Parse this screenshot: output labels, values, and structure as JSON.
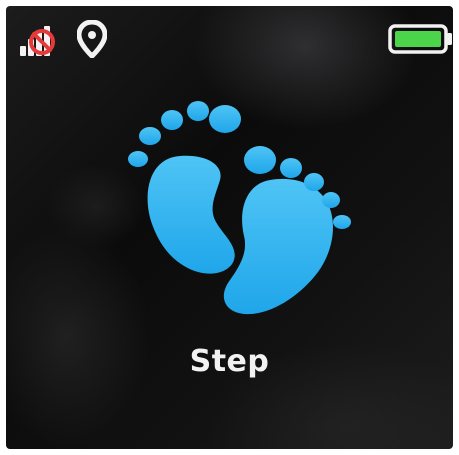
{
  "status_bar": {
    "signal": {
      "icon": "signal-bars-no-sim-icon",
      "state": "no-sim"
    },
    "location": {
      "icon": "location-pin-icon"
    },
    "battery": {
      "icon": "battery-icon",
      "fill_color": "#4cd44a"
    }
  },
  "main": {
    "app_icon": "footprints-icon",
    "app_icon_color": "#35b6f2",
    "app_label": "Step"
  }
}
